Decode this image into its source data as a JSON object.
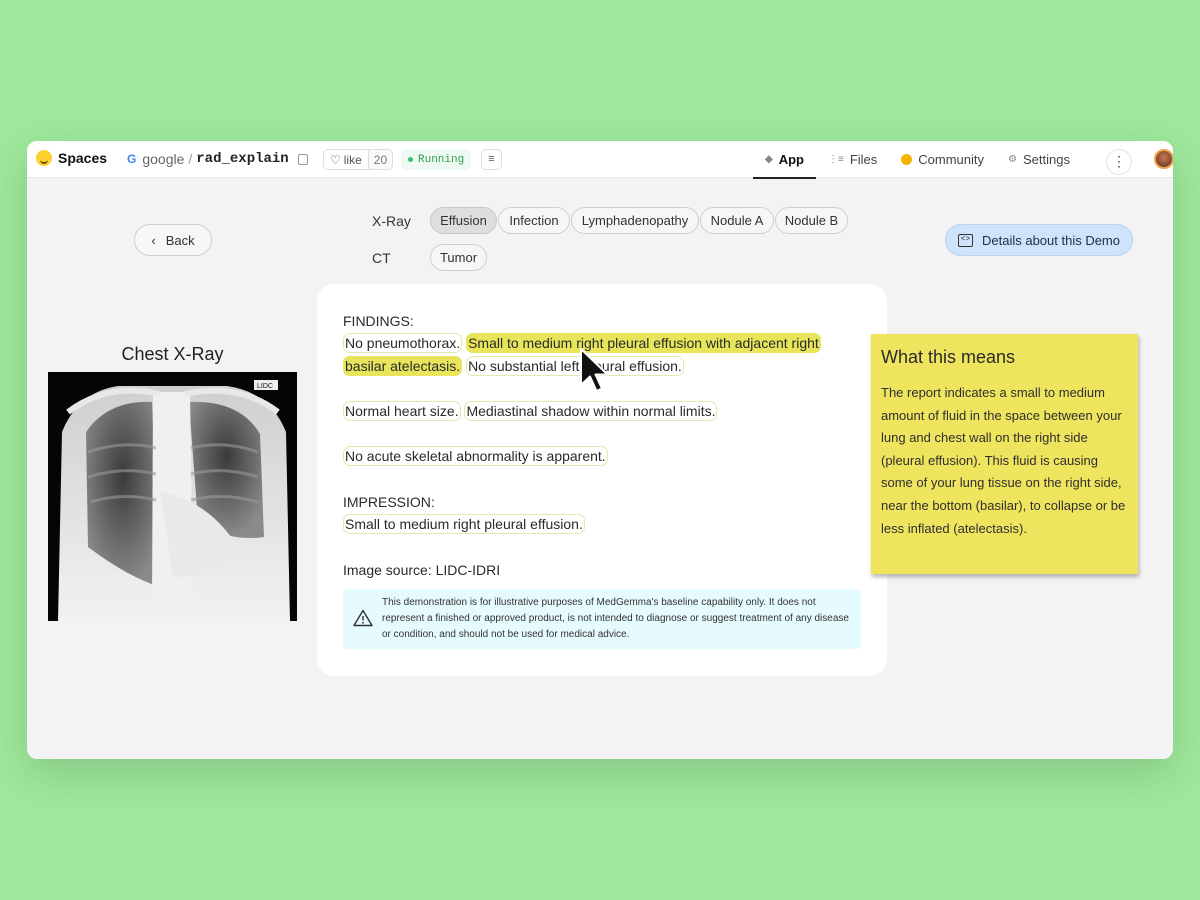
{
  "topbar": {
    "brand": "Spaces",
    "owner": "google",
    "repo": "rad_explain",
    "like_label": "like",
    "like_count": "20",
    "status": "Running",
    "nav": [
      {
        "label": "App",
        "icon": "cube-icon",
        "active": true
      },
      {
        "label": "Files",
        "icon": "files-icon",
        "active": false
      },
      {
        "label": "Community",
        "icon": "community-icon",
        "active": false
      },
      {
        "label": "Settings",
        "icon": "gear-icon",
        "active": false
      }
    ]
  },
  "controls": {
    "back_label": "Back",
    "details_label": "Details about this Demo",
    "xray_label": "X-Ray",
    "ct_label": "CT",
    "xray_chips": [
      "Effusion",
      "Infection",
      "Lymphadenopathy",
      "Nodule A",
      "Nodule B"
    ],
    "ct_chips": [
      "Tumor"
    ],
    "selected_chip": "Effusion"
  },
  "image_panel": {
    "title": "Chest X-Ray",
    "image_label": "LIDC"
  },
  "report": {
    "findings_heading": "FINDINGS:",
    "findings_1a": "No pneumothorax.",
    "findings_1b": "Small to medium right pleural effusion with adjacent right",
    "findings_1c": "basilar atelectasis.",
    "findings_1d": "No substantial left pleural effusion.",
    "findings_2a": "Normal heart size.",
    "findings_2b": "Mediastinal shadow within normal limits.",
    "findings_3": "No acute skeletal abnormality is apparent.",
    "impression_heading": "IMPRESSION:",
    "impression": "Small to medium right pleural effusion.",
    "source": "Image source: LIDC-IDRI",
    "disclaimer": "This demonstration is for illustrative purposes of MedGemma's baseline capability only. It does not represent a finished or approved product, is not intended to diagnose or suggest treatment of any disease or condition, and should not be used for medical advice."
  },
  "explanation": {
    "title": "What this means",
    "body": "The report indicates a small to medium amount of fluid in the space between your lung and chest wall on the right side (pleural effusion). This fluid is causing some of your lung tissue on the right side, near the bottom (basilar), to collapse or be less inflated (atelectasis)."
  },
  "colors": {
    "highlight": "#e8e55a",
    "sticky_note": "#efe45e",
    "details_button": "#cfe3fa",
    "background": "#9de89b"
  }
}
